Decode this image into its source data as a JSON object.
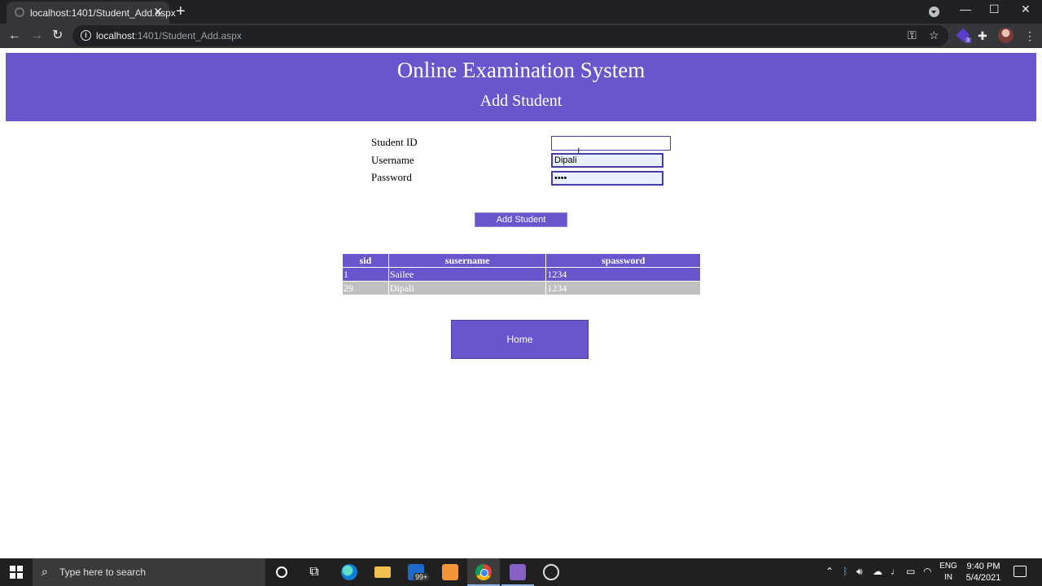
{
  "browser": {
    "tab_title": "localhost:1401/Student_Add.aspx",
    "tab_close": "✕",
    "new_tab": "+",
    "url_host": "localhost",
    "url_path": ":1401/Student_Add.aspx",
    "window_controls": {
      "minimize": "—",
      "maximize": "☐",
      "close": "✕"
    },
    "extension_badge": "3"
  },
  "header": {
    "system_title": "Online Examination System",
    "page_title": "Add Student"
  },
  "form": {
    "student_id_label": "Student ID",
    "student_id_value": "",
    "username_label": "Username",
    "username_value": "Dipali",
    "password_label": "Password",
    "password_value": "••••",
    "add_button": "Add Student"
  },
  "grid": {
    "columns": [
      "sid",
      "susername",
      "spassword"
    ],
    "rows": [
      [
        "1",
        "Sailee",
        "1234"
      ],
      [
        "29",
        "Dipali",
        "1234"
      ]
    ]
  },
  "home_button": "Home",
  "taskbar": {
    "search_placeholder": "Type here to search",
    "mail_badge": "99+",
    "language_line1": "ENG",
    "language_line2": "IN",
    "time": "9:40 PM",
    "date": "5/4/2021"
  },
  "colors": {
    "accent": "#6a55cc",
    "alt_row": "#c0c0c0"
  }
}
